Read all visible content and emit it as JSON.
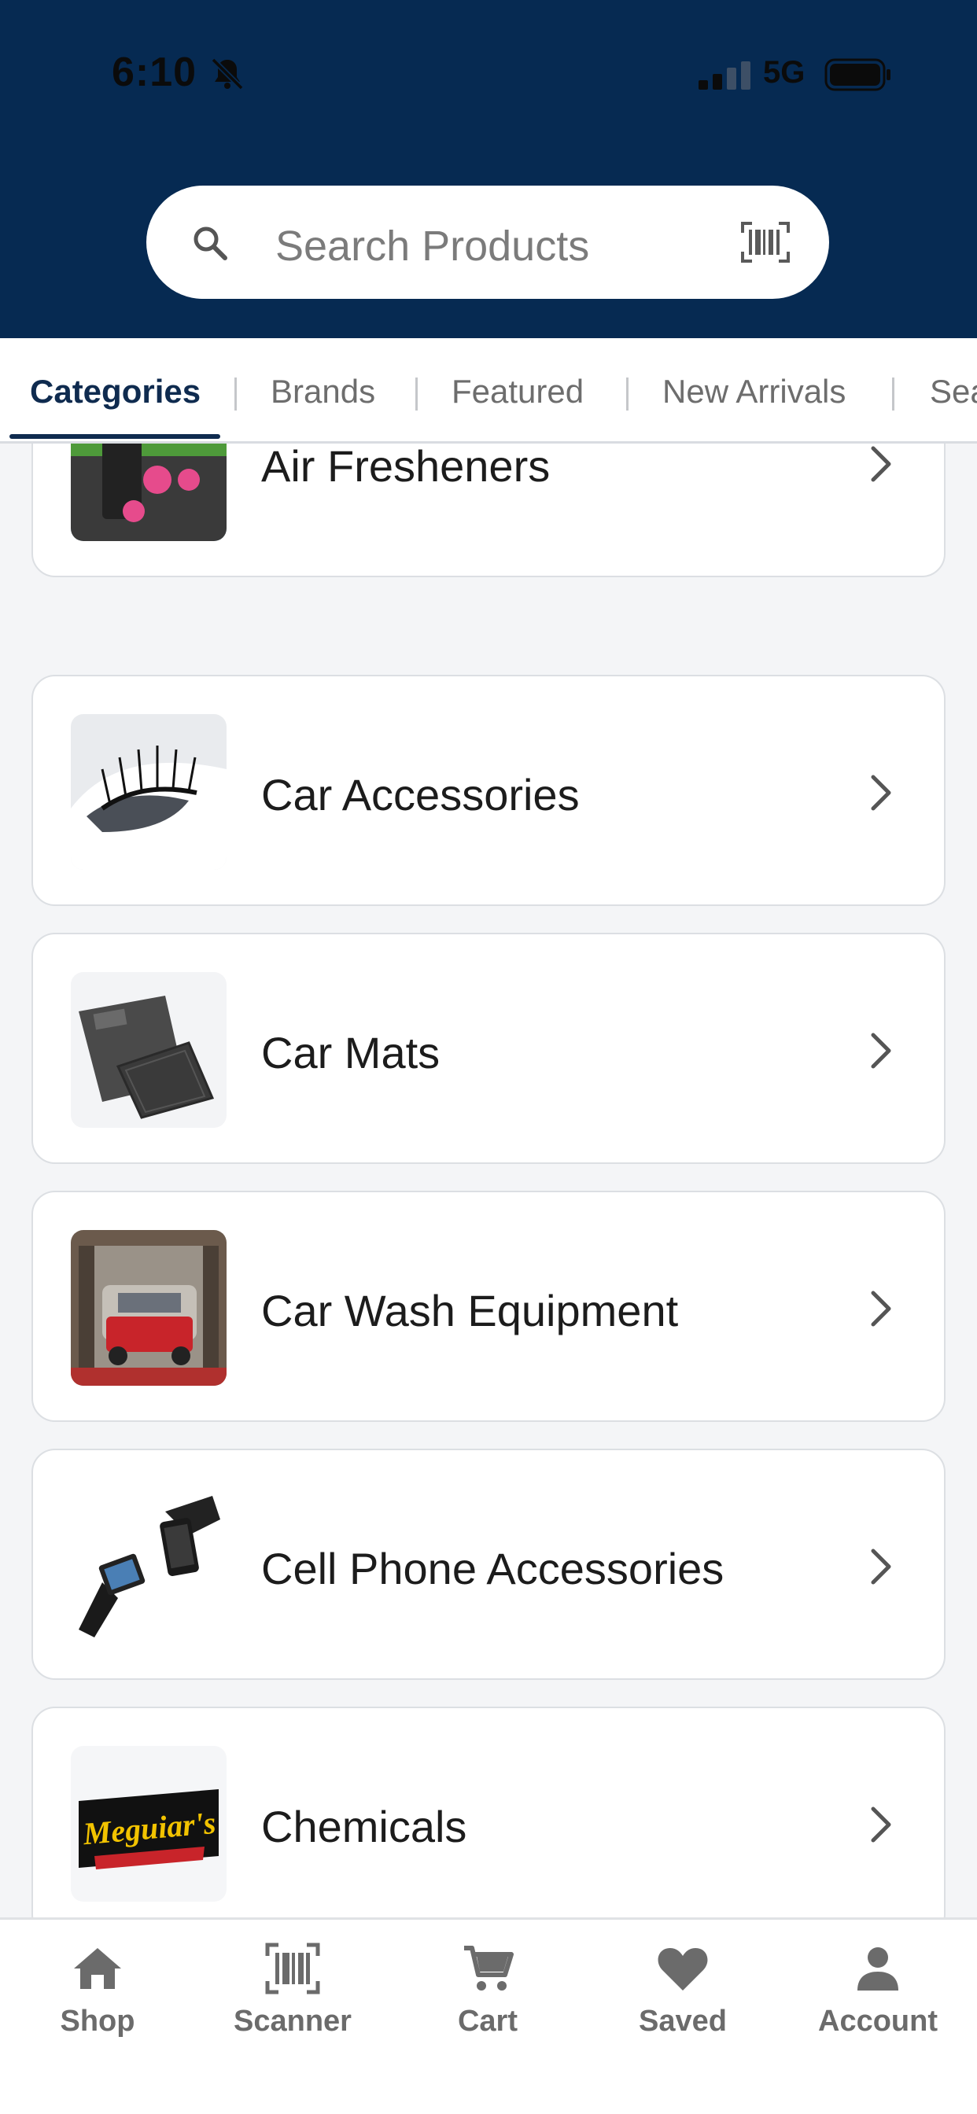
{
  "status_bar": {
    "time": "6:10",
    "network": "5G"
  },
  "search": {
    "placeholder": "Search Products"
  },
  "tabs": [
    {
      "label": "Categories",
      "active": true
    },
    {
      "label": "Brands",
      "active": false
    },
    {
      "label": "Featured",
      "active": false
    },
    {
      "label": "New Arrivals",
      "active": false
    },
    {
      "label": "Sea",
      "active": false
    }
  ],
  "categories": [
    {
      "label": "Air Fresheners",
      "icon": "air-freshener-thumbnail"
    },
    {
      "label": "Car Accessories",
      "icon": "car-eyelashes-thumbnail"
    },
    {
      "label": "Car Mats",
      "icon": "car-mats-thumbnail"
    },
    {
      "label": "Car Wash Equipment",
      "icon": "car-wash-thumbnail"
    },
    {
      "label": "Cell Phone Accessories",
      "icon": "phone-mount-thumbnail"
    },
    {
      "label": "Chemicals",
      "icon": "meguiars-logo-thumbnail"
    }
  ],
  "meguiars_logo_text": "Meguiar's",
  "bottom_nav": [
    {
      "label": "Shop",
      "icon": "home-icon"
    },
    {
      "label": "Scanner",
      "icon": "barcode-icon"
    },
    {
      "label": "Cart",
      "icon": "cart-icon"
    },
    {
      "label": "Saved",
      "icon": "heart-icon"
    },
    {
      "label": "Account",
      "icon": "person-icon"
    }
  ],
  "colors": {
    "header_bg": "#062a52",
    "active_tab": "#0f2b4f",
    "nav_label": "#6b6b6b"
  }
}
